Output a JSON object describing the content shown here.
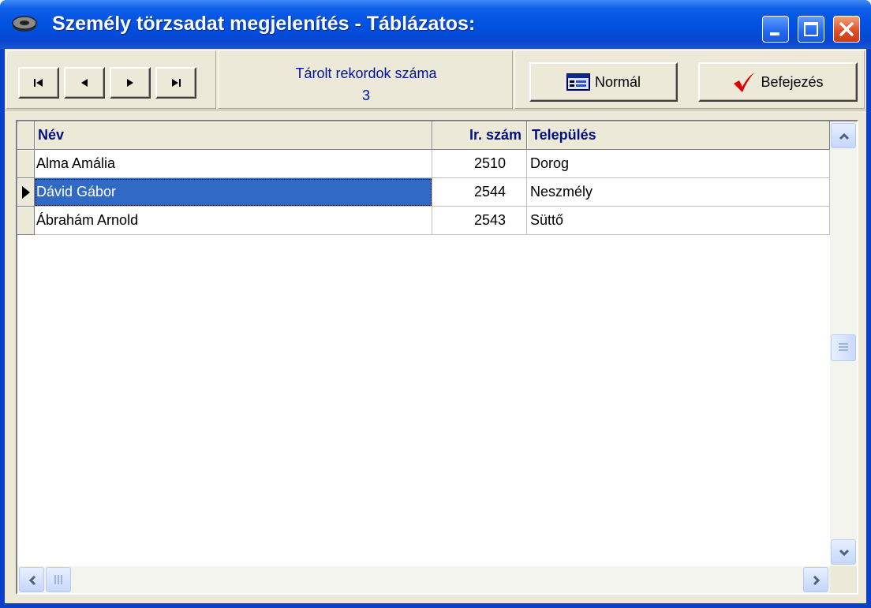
{
  "window": {
    "title": "Személy törzsadat megjelenítés - Táblázatos:",
    "icon": "disk-icon",
    "caption_buttons": [
      "minimize-icon",
      "maximize-icon",
      "close-icon"
    ]
  },
  "toolbar": {
    "nav_buttons": [
      {
        "name": "first-record-icon",
        "glyph": "⏮"
      },
      {
        "name": "prev-record-icon",
        "glyph": "◀"
      },
      {
        "name": "next-record-icon",
        "glyph": "▶"
      },
      {
        "name": "last-record-icon",
        "glyph": "⏭"
      }
    ],
    "record_count_label": "Tárolt rekordok száma",
    "record_count": "3",
    "normal_label": "Normál",
    "finish_label": "Befejezés"
  },
  "grid": {
    "columns": [
      "Név",
      "Ir. szám",
      "Település"
    ],
    "rows": [
      {
        "name": "Alma Amália",
        "zip": "2510",
        "city": "Dorog",
        "current": false
      },
      {
        "name": "Dávid Gábor",
        "zip": "2544",
        "city": "Neszmély",
        "current": true
      },
      {
        "name": "Ábrahám Arnold",
        "zip": "2543",
        "city": "Süttő",
        "current": false
      }
    ]
  },
  "colors": {
    "titlebar": "#0050e0",
    "selection": "#316ac5",
    "header_text": "#001080",
    "check_mark": "#e00000"
  }
}
